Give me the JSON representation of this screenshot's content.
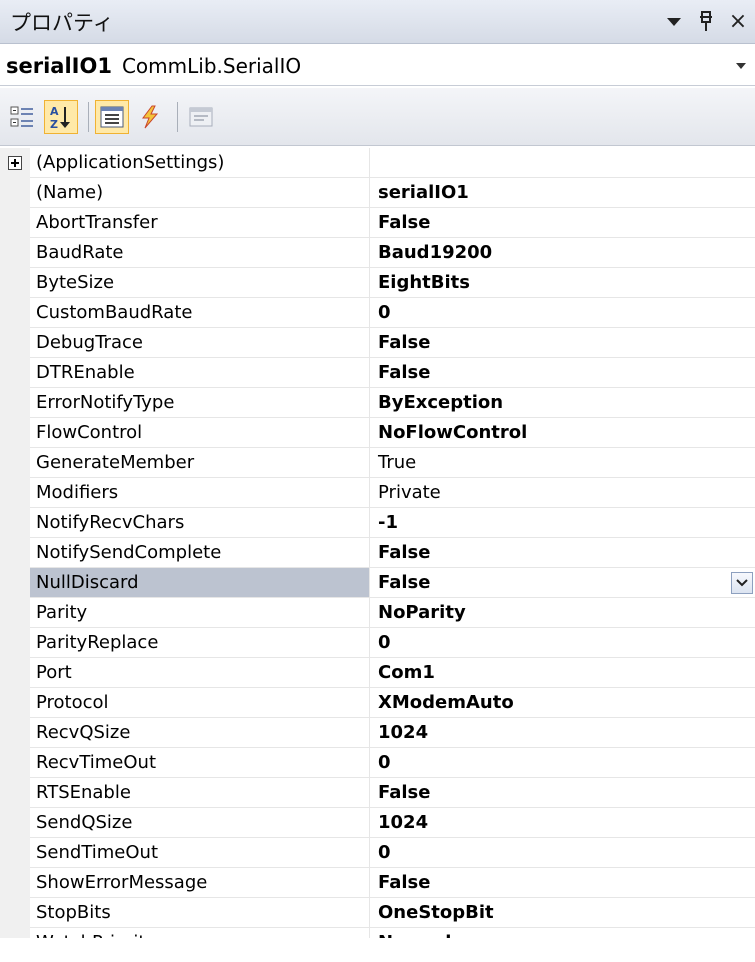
{
  "window": {
    "title": "プロパティ",
    "dropdown_glyph": "▾",
    "pin_glyph": "ᵽ",
    "close_glyph": "×"
  },
  "object_selector": {
    "name": "serialIO1",
    "type": "CommLib.SerialIO",
    "drop_glyph": "▼"
  },
  "toolbar": {
    "buttons": [
      {
        "name": "categorized",
        "active": false
      },
      {
        "name": "alphabetical",
        "active": true
      },
      {
        "name": "properties",
        "active": true
      },
      {
        "name": "events",
        "active": false
      },
      {
        "name": "property-pages",
        "active": false
      }
    ]
  },
  "properties": [
    {
      "name": "(ApplicationSettings)",
      "value": "",
      "bold": false,
      "expandable": true
    },
    {
      "name": "(Name)",
      "value": "serialIO1",
      "bold": true
    },
    {
      "name": "AbortTransfer",
      "value": "False",
      "bold": true
    },
    {
      "name": "BaudRate",
      "value": "Baud19200",
      "bold": true
    },
    {
      "name": "ByteSize",
      "value": "EightBits",
      "bold": true
    },
    {
      "name": "CustomBaudRate",
      "value": "0",
      "bold": true
    },
    {
      "name": "DebugTrace",
      "value": "False",
      "bold": true
    },
    {
      "name": "DTREnable",
      "value": "False",
      "bold": true
    },
    {
      "name": "ErrorNotifyType",
      "value": "ByException",
      "bold": true
    },
    {
      "name": "FlowControl",
      "value": "NoFlowControl",
      "bold": true
    },
    {
      "name": "GenerateMember",
      "value": "True",
      "bold": false
    },
    {
      "name": "Modifiers",
      "value": "Private",
      "bold": false
    },
    {
      "name": "NotifyRecvChars",
      "value": "-1",
      "bold": true
    },
    {
      "name": "NotifySendComplete",
      "value": "False",
      "bold": true
    },
    {
      "name": "NullDiscard",
      "value": "False",
      "bold": true,
      "selected": true
    },
    {
      "name": "Parity",
      "value": "NoParity",
      "bold": true
    },
    {
      "name": "ParityReplace",
      "value": "0",
      "bold": true
    },
    {
      "name": "Port",
      "value": "Com1",
      "bold": true
    },
    {
      "name": "Protocol",
      "value": "XModemAuto",
      "bold": true
    },
    {
      "name": "RecvQSize",
      "value": "1024",
      "bold": true
    },
    {
      "name": "RecvTimeOut",
      "value": "0",
      "bold": true
    },
    {
      "name": "RTSEnable",
      "value": "False",
      "bold": true
    },
    {
      "name": "SendQSize",
      "value": "1024",
      "bold": true
    },
    {
      "name": "SendTimeOut",
      "value": "0",
      "bold": true
    },
    {
      "name": "ShowErrorMessage",
      "value": "False",
      "bold": true
    },
    {
      "name": "StopBits",
      "value": "OneStopBit",
      "bold": true
    },
    {
      "name": "WatchPriority",
      "value": "Normal",
      "bold": true
    }
  ],
  "value_dropdown_glyph": "⌄"
}
